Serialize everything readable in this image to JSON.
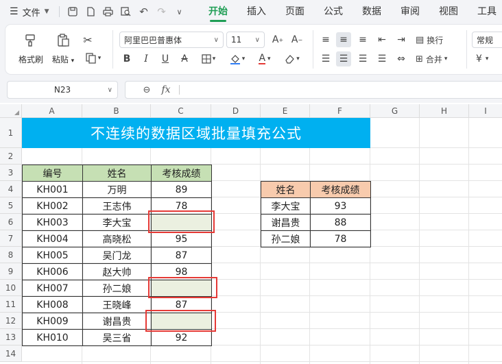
{
  "menu": {
    "file_label": "文件",
    "tabs": [
      "开始",
      "插入",
      "页面",
      "公式",
      "数据",
      "审阅",
      "视图",
      "工具"
    ],
    "active_tab": "开始"
  },
  "ribbon": {
    "format_painter": "格式刷",
    "paste": "粘贴",
    "font_name": "阿里巴巴普惠体",
    "font_size": "11",
    "wrap": "换行",
    "merge": "合并",
    "number_format": "常规",
    "currency_symbol": "¥"
  },
  "formula_bar": {
    "name_box": "N23",
    "fx_label": "fx",
    "formula": ""
  },
  "sheet": {
    "columns": [
      "A",
      "B",
      "C",
      "D",
      "E",
      "F",
      "G",
      "H",
      "I"
    ],
    "rows": [
      "1",
      "2",
      "3",
      "4",
      "5",
      "6",
      "7",
      "8",
      "9",
      "10",
      "11",
      "12",
      "13",
      "14"
    ],
    "title": "不连续的数据区域批量填充公式",
    "main_table": {
      "headers": [
        "编号",
        "姓名",
        "考核成绩"
      ],
      "rows": [
        [
          "KH001",
          "万明",
          "89"
        ],
        [
          "KH002",
          "王志伟",
          "78"
        ],
        [
          "KH003",
          "李大宝",
          ""
        ],
        [
          "KH004",
          "高晓松",
          "95"
        ],
        [
          "KH005",
          "吴门龙",
          "87"
        ],
        [
          "KH006",
          "赵大帅",
          "98"
        ],
        [
          "KH007",
          "孙二娘",
          ""
        ],
        [
          "KH008",
          "王晓峰",
          "87"
        ],
        [
          "KH009",
          "谢昌贵",
          ""
        ],
        [
          "KH010",
          "吴三省",
          "92"
        ]
      ]
    },
    "lookup_table": {
      "headers": [
        "姓名",
        "考核成绩"
      ],
      "rows": [
        [
          "李大宝",
          "93"
        ],
        [
          "谢昌贵",
          "88"
        ],
        [
          "孙二娘",
          "78"
        ]
      ]
    }
  },
  "colors": {
    "accent": "#1f9e55",
    "title_fill": "#00b0f0",
    "header_green": "#c6e0b4",
    "header_orange": "#f8cbad",
    "blank_fill": "#ebf0e0",
    "highlight_red": "#e53935"
  }
}
